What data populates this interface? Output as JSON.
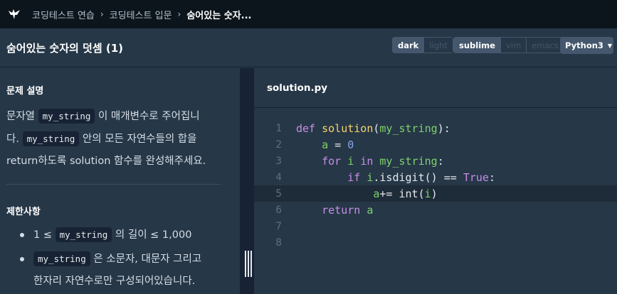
{
  "breadcrumb": [
    "코딩테스트 연습",
    "코딩테스트 입문",
    "숨어있는 숫자..."
  ],
  "problem_title": "숨어있는 숫자의 덧셈 (1)",
  "theme_toggle": {
    "dark": "dark",
    "light": "light",
    "selected": "dark"
  },
  "keymap_toggle": {
    "sublime": "sublime",
    "vim": "vim",
    "emacs": "emacs",
    "selected": "sublime"
  },
  "language_select": {
    "value": "Python3"
  },
  "description": {
    "heading": "문제 설명",
    "line1_pre": "문자열 ",
    "chip1": "my_string",
    "line1_post": " 이 매개변수로 주어집니",
    "line2_pre": "다. ",
    "chip2": "my_string",
    "line2_post": " 안의 모든 자연수들의 합을",
    "line3": "return하도록 solution 함수를 완성해주세요."
  },
  "constraints": {
    "heading": "제한사항",
    "item1_pre": "1 ≤ ",
    "item1_chip": "my_string",
    "item1_post": " 의 길이 ≤ 1,000",
    "item2_chip": "my_string",
    "item2_post": " 은 소문자, 대문자 그리고",
    "item2_line2": "한자리 자연수로만 구성되어있습니다."
  },
  "editor": {
    "filename": "solution.py",
    "line_numbers": [
      "1",
      "2",
      "3",
      "4",
      "5",
      "6",
      "7",
      "8"
    ],
    "lines": [
      "def solution(my_string):",
      "    a = 0",
      "    for i in my_string:",
      "        if i.isdigit() == True:",
      "            a+= int(i)",
      "    return a",
      "",
      ""
    ],
    "active_line": 5
  },
  "colors": {
    "topbar_bg": "#0c151c",
    "panel_bg": "#263747",
    "keyword": "#c88ee8",
    "function_name": "#f7d46c",
    "identifier": "#7ed26d",
    "number": "#86a7ea"
  }
}
